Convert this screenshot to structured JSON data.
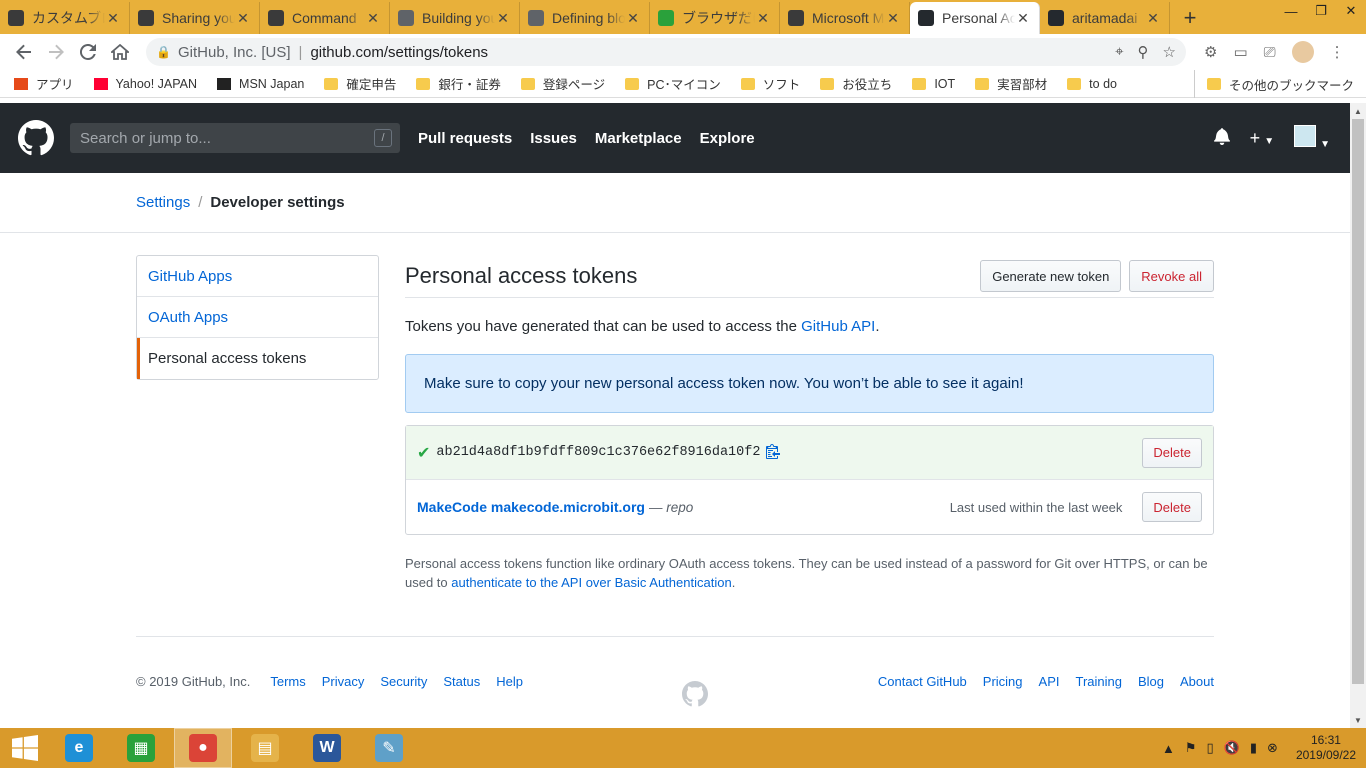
{
  "browser": {
    "tabs": [
      {
        "title": "カスタムブロック",
        "icon": "makecode-icon",
        "active": false
      },
      {
        "title": "Sharing your",
        "icon": "makecode-icon",
        "active": false
      },
      {
        "title": "Command",
        "icon": "makecode-icon",
        "active": false
      },
      {
        "title": "Building your",
        "icon": "globe-icon",
        "active": false
      },
      {
        "title": "Defining blocks",
        "icon": "globe-icon",
        "active": false
      },
      {
        "title": "ブラウザだけで",
        "icon": "q-icon",
        "active": false
      },
      {
        "title": "Microsoft M",
        "icon": "makecode-icon",
        "active": false
      },
      {
        "title": "Personal Access",
        "icon": "github-icon",
        "active": true
      },
      {
        "title": "aritamadai",
        "icon": "github-icon",
        "active": false
      }
    ],
    "new_tab": "+",
    "close": "✕",
    "window_controls": {
      "minimize": "—",
      "maximize": "❐",
      "close": "✕"
    },
    "omnibox": {
      "org": "GitHub, Inc. [US]",
      "url": "github.com/settings/tokens"
    },
    "bookmarks": [
      {
        "label": "アプリ",
        "icon": "apps-grid-icon"
      },
      {
        "label": "Yahoo! JAPAN",
        "icon": "yahoo-icon"
      },
      {
        "label": "MSN Japan",
        "icon": "msn-icon"
      },
      {
        "label": "確定申告",
        "icon": "folder-icon"
      },
      {
        "label": "銀行・証券",
        "icon": "folder-icon"
      },
      {
        "label": "登録ページ",
        "icon": "folder-icon"
      },
      {
        "label": "PC･マイコン",
        "icon": "folder-icon"
      },
      {
        "label": "ソフト",
        "icon": "folder-icon"
      },
      {
        "label": "お役立ち",
        "icon": "folder-icon"
      },
      {
        "label": "IOT",
        "icon": "folder-icon"
      },
      {
        "label": "実習部材",
        "icon": "folder-icon"
      },
      {
        "label": "to do",
        "icon": "folder-icon"
      }
    ],
    "other_bookmarks": "その他のブックマーク"
  },
  "github": {
    "search_placeholder": "Search or jump to...",
    "search_shortcut": "/",
    "nav": [
      "Pull requests",
      "Issues",
      "Marketplace",
      "Explore"
    ],
    "breadcrumb": {
      "parent": "Settings",
      "current": "Developer settings"
    },
    "sidebar": [
      {
        "label": "GitHub Apps",
        "selected": false
      },
      {
        "label": "OAuth Apps",
        "selected": false
      },
      {
        "label": "Personal access tokens",
        "selected": true
      }
    ],
    "main": {
      "title": "Personal access tokens",
      "generate_button": "Generate new token",
      "revoke_button": "Revoke all",
      "intro_text": "Tokens you have generated that can be used to access the ",
      "intro_link": "GitHub API",
      "intro_end": ".",
      "flash": "Make sure to copy your new personal access token now. You won’t be able to see it again!",
      "new_token": "ab21d4a8df1b9fdff809c1c376e62f8916da10f2",
      "delete_label": "Delete",
      "token": {
        "name": "MakeCode makecode.microbit.org",
        "scope": "— repo",
        "last_used": "Last used within the last week"
      },
      "note_text": "Personal access tokens function like ordinary OAuth access tokens. They can be used instead of a password for Git over HTTPS, or can be used to ",
      "note_link": "authenticate to the API over Basic Authentication",
      "note_end": "."
    },
    "footer": {
      "copyright": "© 2019 GitHub, Inc.",
      "left_links": [
        "Terms",
        "Privacy",
        "Security",
        "Status",
        "Help"
      ],
      "right_links": [
        "Contact GitHub",
        "Pricing",
        "API",
        "Training",
        "Blog",
        "About"
      ]
    }
  },
  "taskbar": {
    "apps": [
      {
        "name": "ie",
        "glyph": "e",
        "color": "#1e90d6"
      },
      {
        "name": "store",
        "glyph": "▦",
        "color": "#2aa13b"
      },
      {
        "name": "chrome",
        "glyph": "●",
        "color": "#db4437"
      },
      {
        "name": "explorer",
        "glyph": "▤",
        "color": "#e5b34a"
      },
      {
        "name": "word",
        "glyph": "W",
        "color": "#2b579a"
      },
      {
        "name": "notepad",
        "glyph": "✎",
        "color": "#5fa0c8"
      }
    ],
    "active_app": "chrome",
    "time": "16:31",
    "date": "2019/09/22"
  },
  "colors": {
    "github_header": "#24292e",
    "link": "#0366d6",
    "danger": "#cb2431",
    "flash_bg": "#dbedff",
    "success": "#28a745",
    "chrome_frame": "#e8b03a",
    "taskbar": "#d99a2b"
  }
}
